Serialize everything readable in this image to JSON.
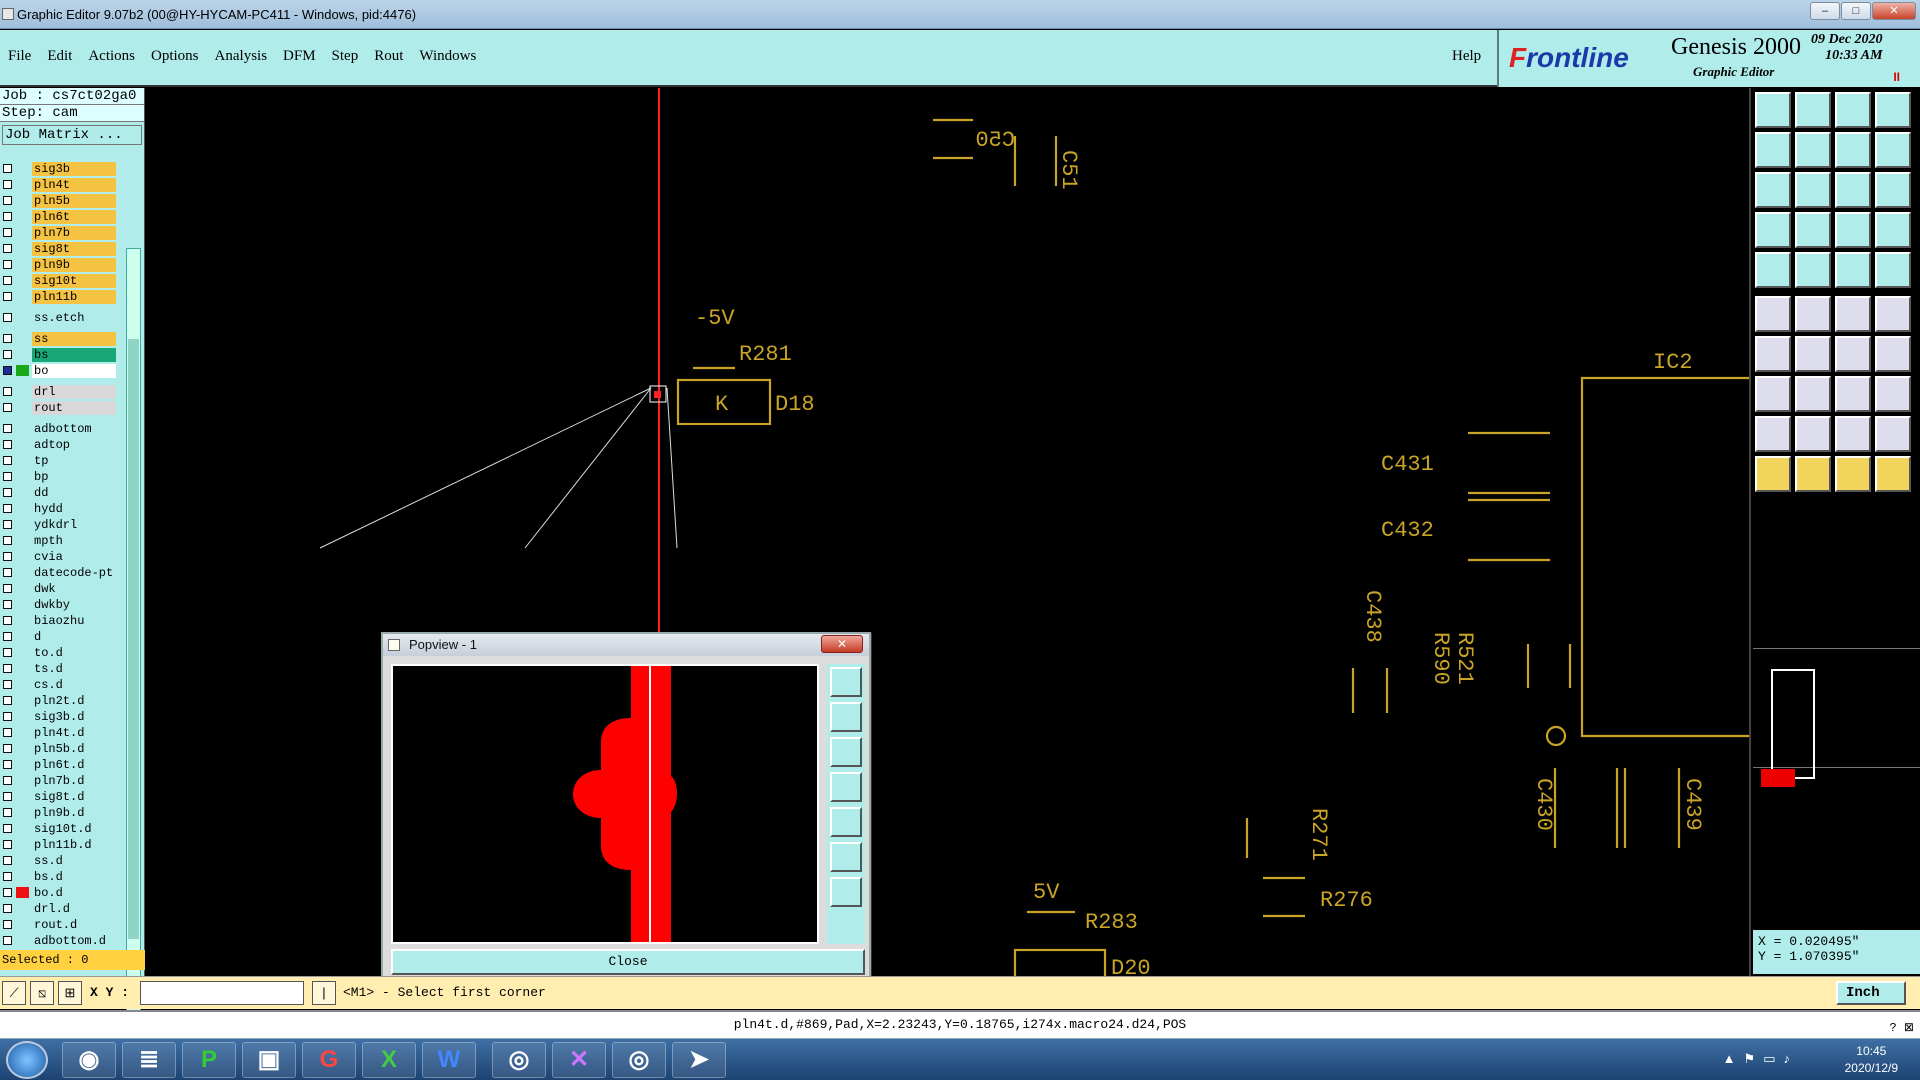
{
  "window": {
    "title": "Graphic Editor 9.07b2 (00@HY-HYCAM-PC411 - Windows, pid:4476)",
    "min": "–",
    "max": "□",
    "close": "✕"
  },
  "menu": {
    "items": [
      "File",
      "Edit",
      "Actions",
      "Options",
      "Analysis",
      "DFM",
      "Step",
      "Rout",
      "Windows"
    ],
    "help": "Help"
  },
  "brand": {
    "logo_pre": "F",
    "logo_rest": "rontline",
    "product": "Genesis 2000",
    "subtitle": "Graphic Editor",
    "date": "09 Dec 2020",
    "time": "10:33 AM",
    "indicator": "II"
  },
  "job": {
    "job_label": "Job : cs7ct02ga0",
    "step_label": "Step: cam",
    "matrix_button": "Job Matrix ..."
  },
  "layers": [
    {
      "name": "sig3b",
      "color": "#f5c242"
    },
    {
      "name": "pln4t",
      "color": "#f5c242"
    },
    {
      "name": "pln5b",
      "color": "#f5c242"
    },
    {
      "name": "pln6t",
      "color": "#f5c242"
    },
    {
      "name": "pln7b",
      "color": "#f5c242"
    },
    {
      "name": "sig8t",
      "color": "#f5c242"
    },
    {
      "name": "pln9b",
      "color": "#f5c242"
    },
    {
      "name": "sig10t",
      "color": "#f5c242"
    },
    {
      "name": "pln11b",
      "color": "#f5c242"
    },
    {
      "gap": true
    },
    {
      "name": "ss.etch",
      "color": "#b0ecea"
    },
    {
      "gap": true
    },
    {
      "name": "ss",
      "color": "#f5c242"
    },
    {
      "name": "bs",
      "color": "#18a878"
    },
    {
      "name": "bo",
      "color": "#ffffff",
      "swatch": "#18a818",
      "active": true
    },
    {
      "gap": true
    },
    {
      "name": "drl",
      "color": "#d8d8d8"
    },
    {
      "name": "rout",
      "color": "#d8d8d8"
    },
    {
      "gap": true
    },
    {
      "name": "adbottom",
      "color": "#b0ecea",
      "arrow": true
    },
    {
      "name": "adtop",
      "color": "#b0ecea",
      "arrow": true
    },
    {
      "name": "tp",
      "color": "#b0ecea"
    },
    {
      "name": "bp",
      "color": "#b0ecea"
    },
    {
      "name": "dd",
      "color": "#b0ecea"
    },
    {
      "name": "hydd",
      "color": "#b0ecea"
    },
    {
      "name": "ydkdrl",
      "color": "#b0ecea"
    },
    {
      "name": "mpth",
      "color": "#b0ecea"
    },
    {
      "name": "cvia",
      "color": "#b0ecea"
    },
    {
      "name": "datecode-pt",
      "color": "#b0ecea"
    },
    {
      "name": "dwk",
      "color": "#b0ecea"
    },
    {
      "name": "dwkby",
      "color": "#b0ecea"
    },
    {
      "name": "biaozhu",
      "color": "#b0ecea"
    },
    {
      "name": "d",
      "color": "#b0ecea"
    },
    {
      "name": "to.d",
      "color": "#b0ecea",
      "arrow": true
    },
    {
      "name": "ts.d",
      "color": "#b0ecea"
    },
    {
      "name": "cs.d",
      "color": "#b0ecea"
    },
    {
      "name": "pln2t.d",
      "color": "#b0ecea"
    },
    {
      "name": "sig3b.d",
      "color": "#b0ecea"
    },
    {
      "name": "pln4t.d",
      "color": "#b0ecea"
    },
    {
      "name": "pln5b.d",
      "color": "#b0ecea"
    },
    {
      "name": "pln6t.d",
      "color": "#b0ecea"
    },
    {
      "name": "pln7b.d",
      "color": "#b0ecea"
    },
    {
      "name": "sig8t.d",
      "color": "#b0ecea"
    },
    {
      "name": "pln9b.d",
      "color": "#b0ecea"
    },
    {
      "name": "sig10t.d",
      "color": "#b0ecea"
    },
    {
      "name": "pln11b.d",
      "color": "#b0ecea"
    },
    {
      "name": "ss.d",
      "color": "#b0ecea"
    },
    {
      "name": "bs.d",
      "color": "#b0ecea"
    },
    {
      "name": "bo.d",
      "color": "#b0ecea",
      "swatch": "#ee1111",
      "arrow": true
    },
    {
      "name": "drl.d",
      "color": "#b0ecea"
    },
    {
      "name": "rout.d",
      "color": "#b0ecea"
    },
    {
      "name": "adbottom.d",
      "color": "#b0ecea",
      "arrow": true
    }
  ],
  "selected": "Selected : 0",
  "canvas_labels": {
    "c50": "C50",
    "c51": "C51",
    "v5neg": "-5V",
    "r281": "R281",
    "d18": "D18",
    "d18_pin": "K",
    "ic2": "IC2",
    "c431": "C431",
    "c432": "C432",
    "c438": "C438",
    "r590": "R590",
    "r521": "R521",
    "c430": "C430",
    "c439": "C439",
    "r271": "R271",
    "r276": "R276",
    "v5": "5V",
    "r283": "R283",
    "d20": "D20"
  },
  "popview": {
    "title": "Popview - 1",
    "close_label": "Close"
  },
  "coords": {
    "x": "X = 0.020495\"",
    "y": "Y = 1.070395\""
  },
  "cmd": {
    "xy_label": "X Y :",
    "xy_value": "",
    "prompt": "<M1> - Select first corner",
    "unit": "Inch"
  },
  "status": "pln4t.d,#869,Pad,X=2.23243,Y=0.18765,i274x.macro24.d24,POS",
  "taskbar": {
    "clock_time": "10:45",
    "clock_date": "2020/12/9"
  },
  "colors": {
    "panel": "#b0ecea",
    "silk": "#c9a427",
    "highlight": "#ff0000"
  }
}
